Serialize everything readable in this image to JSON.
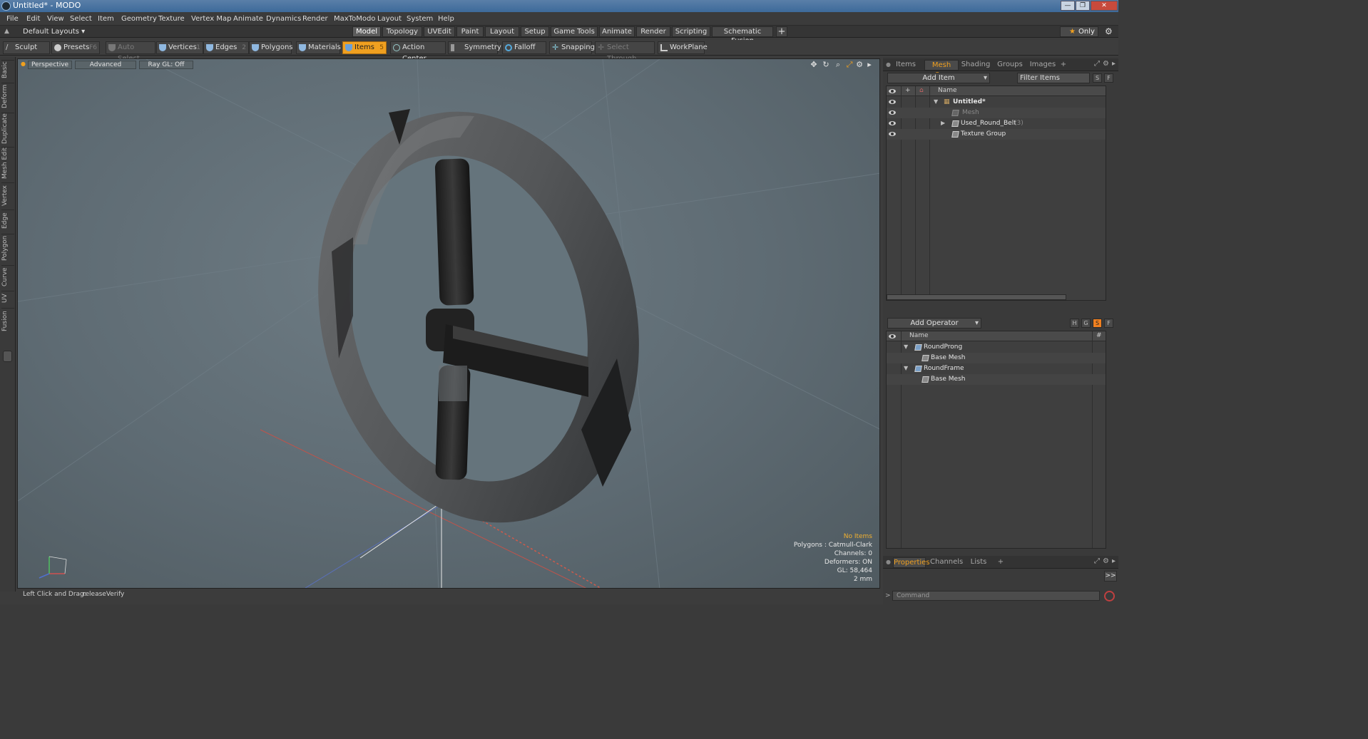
{
  "window": {
    "title": "Untitled* - MODO",
    "controls": [
      "—",
      "❐",
      "✕"
    ]
  },
  "menu": [
    "File",
    "Edit",
    "View",
    "Select",
    "Item",
    "Geometry",
    "Texture",
    "Vertex Map",
    "Animate",
    "Dynamics",
    "Render",
    "MaxToModo",
    "Layout",
    "System",
    "Help"
  ],
  "layout": {
    "current": "Default Layouts ▾",
    "tabs": [
      "Model",
      "Topology",
      "UVEdit",
      "Paint",
      "Layout",
      "Setup",
      "Game Tools",
      "Animate",
      "Render",
      "Scripting",
      "Schematic Fusion"
    ],
    "active_tab": "Model",
    "add_tab": "+",
    "only_label": "Only"
  },
  "toolbar": {
    "sculpt": "Sculpt",
    "presets": "Presets",
    "presets_key": "F6",
    "auto_select": "Auto Select",
    "vertices": "Vertices",
    "vertices_key": "1",
    "edges": "Edges",
    "edges_key": "2",
    "polygons": "Polygons",
    "materials": "Materials",
    "items": "Items",
    "items_key": "5",
    "action_center": "Action Center",
    "symmetry": "Symmetry",
    "falloff": "Falloff",
    "snapping": "Snapping",
    "select_through": "Select Through",
    "workplane": "WorkPlane"
  },
  "left_tabs": [
    "Basic",
    "Deform",
    "Duplicate",
    "Mesh Edit",
    "Vertex",
    "Edge",
    "Polygon",
    "Curve",
    "UV",
    "Fusion"
  ],
  "viewport": {
    "view": "Perspective",
    "advanced": "Advanced",
    "raygl": "Ray GL: Off",
    "info": {
      "no_items": "No Items",
      "polygons": "Polygons : Catmull-Clark",
      "channels": "Channels: 0",
      "deformers": "Deformers: ON",
      "gl": "GL: 58,464",
      "scale": "2 mm"
    }
  },
  "status": {
    "label": "Left Click and Drag:",
    "value": "releaseVerify"
  },
  "items_panel": {
    "tabs": [
      "Items",
      "Mesh Ops",
      "Shading",
      "Groups",
      "Images",
      "+"
    ],
    "active_tab": "Mesh Ops",
    "add_item": "Add Item",
    "filter": "Filter Items",
    "s": "S",
    "f": "F",
    "name_header": "Name",
    "rows": [
      {
        "label": "Untitled*",
        "count": ""
      },
      {
        "label": "Mesh",
        "count": ""
      },
      {
        "label": "Used_Round_Belt",
        "count": "(3)"
      },
      {
        "label": "Texture Group",
        "count": ""
      }
    ]
  },
  "meshops_panel": {
    "add_operator": "Add Operator",
    "h": "H",
    "g": "G",
    "s": "S",
    "f": "F",
    "name_header": "Name",
    "hash_header": "#",
    "rows": [
      {
        "label": "RoundProng"
      },
      {
        "label": "Base Mesh"
      },
      {
        "label": "RoundFrame"
      },
      {
        "label": "Base Mesh"
      }
    ]
  },
  "properties_panel": {
    "tabs": [
      "Properties",
      "Channels",
      "Lists",
      "+"
    ],
    "active_tab": "Properties",
    "expand": ">>"
  },
  "command": {
    "placeholder": "Command"
  }
}
